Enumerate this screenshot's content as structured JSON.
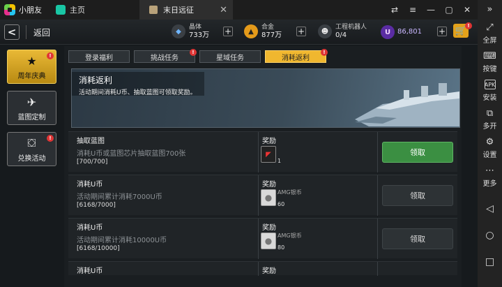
{
  "app": {
    "name": "小朋友",
    "home_tab": "主页",
    "game_tab": "末日远征",
    "tab_close": "✕"
  },
  "window": {
    "controls": [
      "⇄",
      "≡",
      "—",
      "▢",
      "✕"
    ]
  },
  "sidepanel": {
    "collapse": "»",
    "items": [
      {
        "icon": "⤢",
        "label": "全屏"
      },
      {
        "icon": "⌨",
        "label": "按键"
      },
      {
        "icon": "APK",
        "label": "安装"
      },
      {
        "icon": "⧉",
        "label": "多开"
      },
      {
        "icon": "⚙",
        "label": "设置"
      },
      {
        "icon": "⋯",
        "label": "更多"
      }
    ],
    "nav": [
      "◁",
      "○",
      "□"
    ]
  },
  "topbar": {
    "back_label": "返回",
    "resources": [
      {
        "name": "晶体",
        "value": "733万",
        "icon": "◆"
      },
      {
        "name": "合金",
        "value": "877万",
        "icon": "▲"
      },
      {
        "name": "工程机器人",
        "value": "0/4",
        "icon": "☻"
      }
    ],
    "u_currency": "86,801",
    "u_symbol": "U",
    "plus": "+",
    "badge": "!"
  },
  "left_nav": [
    {
      "label": "周年庆典",
      "icon": "★",
      "active": true,
      "badge": "!"
    },
    {
      "label": "蓝图定制",
      "icon": "✈",
      "active": false
    },
    {
      "label": "兑换活动",
      "icon": "⛋",
      "active": false,
      "badge": "!"
    }
  ],
  "tabs": [
    {
      "label": "登录福利",
      "active": false
    },
    {
      "label": "挑战任务",
      "active": false,
      "badge": "!"
    },
    {
      "label": "星域任务",
      "active": false
    },
    {
      "label": "消耗返利",
      "active": true,
      "badge": "!"
    }
  ],
  "banner": {
    "title": "消耗返利",
    "desc": "活动期间消耗U币、抽取蓝图可领取奖励。"
  },
  "rows": [
    {
      "title": "抽取蓝图",
      "desc": "消耗U币或蓝图芯片抽取蓝图700张",
      "progress": "[700/700]",
      "reward_label": "奖励",
      "reward_name": "",
      "reward_qty": "1",
      "claim": "领取",
      "claimable": true
    },
    {
      "title": "消耗U币",
      "desc": "活动期间累计消耗7000U币",
      "progress": "[6168/7000]",
      "reward_label": "奖励",
      "reward_name": "AMG银币",
      "reward_qty": "60",
      "claim": "领取",
      "claimable": false
    },
    {
      "title": "消耗U币",
      "desc": "活动期间累计消耗10000U币",
      "progress": "[6168/10000]",
      "reward_label": "奖励",
      "reward_name": "AMG银币",
      "reward_qty": "80",
      "claim": "领取",
      "claimable": false
    },
    {
      "title": "消耗U币",
      "desc": "",
      "progress": "",
      "reward_label": "奖励",
      "reward_name": "",
      "reward_qty": "",
      "claim": "",
      "claimable": false
    }
  ]
}
